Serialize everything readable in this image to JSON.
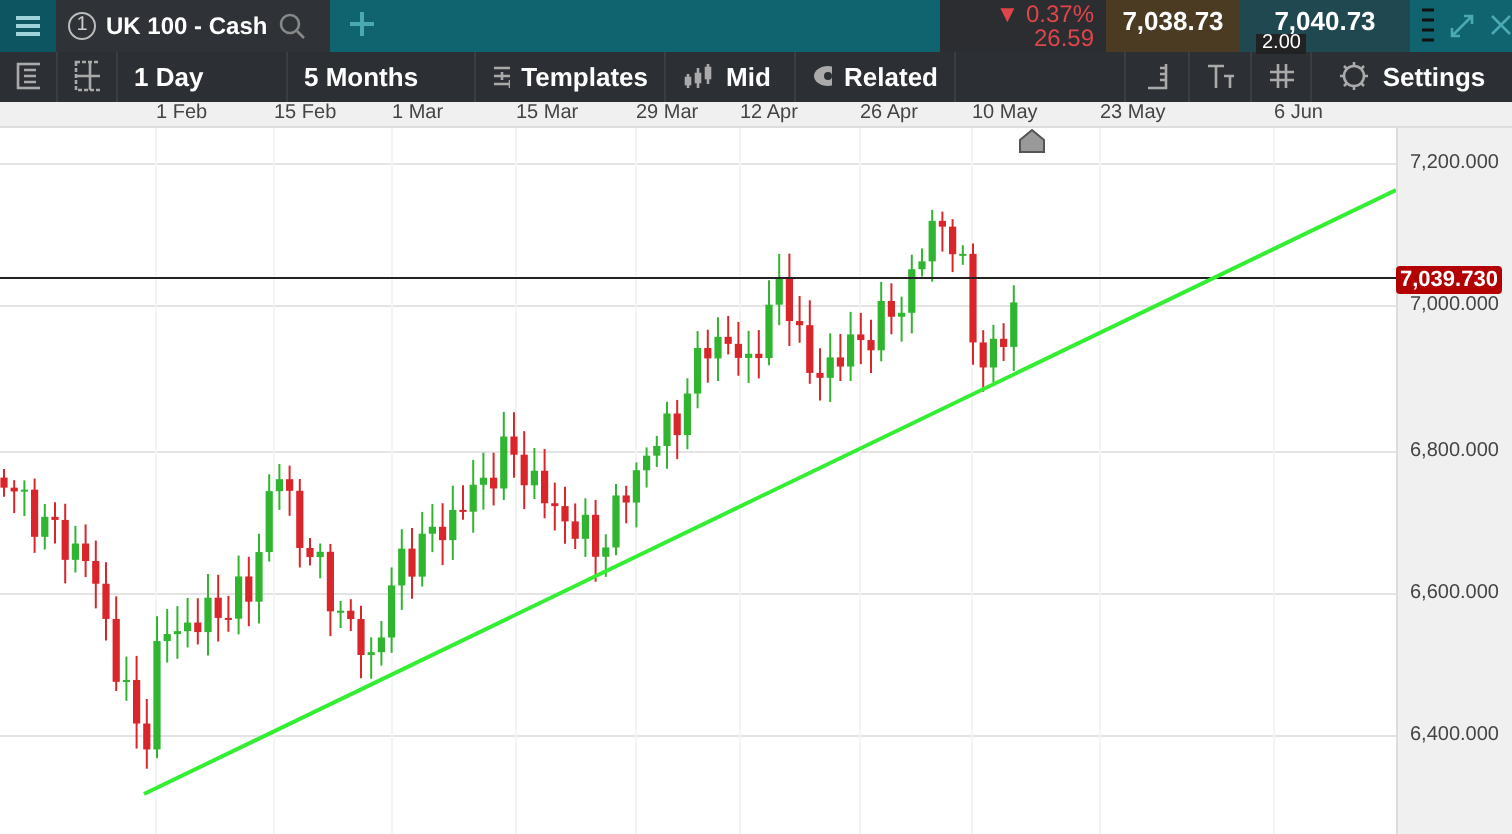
{
  "top_bar": {
    "instrument_tab": {
      "number": "1",
      "label": "UK 100 - Cash"
    },
    "change": {
      "arrow": "▼",
      "percent": "0.37%",
      "points": "26.59"
    },
    "sell_price": "7,038.73",
    "buy_price": "7,040.73",
    "spread": "2.00"
  },
  "toolbar": [
    {
      "kind": "icon"
    },
    {
      "kind": "icon"
    },
    {
      "kind": "text",
      "label": "1 Day"
    },
    {
      "kind": "text",
      "label": "5 Months"
    },
    {
      "kind": "text",
      "label": "Templates"
    },
    {
      "kind": "text",
      "label": "Mid"
    },
    {
      "kind": "text",
      "label": "Related"
    },
    {
      "kind": "spacer"
    },
    {
      "kind": "icon"
    },
    {
      "kind": "icon"
    },
    {
      "kind": "icon"
    },
    {
      "kind": "text",
      "label": "Settings"
    }
  ],
  "date_axis": [
    "1 Feb",
    "15 Feb",
    "1 Mar",
    "15 Mar",
    "29 Mar",
    "12 Apr",
    "26 Apr",
    "10 May",
    "23 May",
    "6 Jun"
  ],
  "price_axis": [
    "7,200.000",
    "7,000.000",
    "6,800.000",
    "6,600.000",
    "6,400.000"
  ],
  "current_price": "7,039.730"
}
